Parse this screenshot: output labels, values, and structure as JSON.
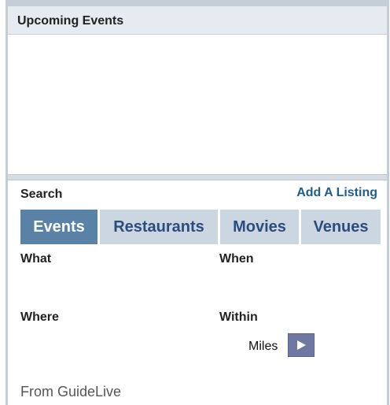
{
  "upcoming": {
    "title": "Upcoming Events"
  },
  "search": {
    "label": "Search",
    "add_listing": "Add A Listing",
    "tabs": [
      {
        "label": "Events",
        "active": true
      },
      {
        "label": "Restaurants",
        "active": false
      },
      {
        "label": "Movies",
        "active": false
      },
      {
        "label": "Venues",
        "active": false
      }
    ],
    "fields": {
      "what": "What",
      "when": "When",
      "where": "Where",
      "within": "Within",
      "miles": "Miles"
    },
    "go_icon": "play-arrow-icon"
  },
  "footer": {
    "source": "From GuideLive"
  },
  "colors": {
    "tab_active": "#5a82a6",
    "tab_inactive": "#ccd6e0",
    "link": "#1f5d8f",
    "go_button": "#6f77a3"
  }
}
